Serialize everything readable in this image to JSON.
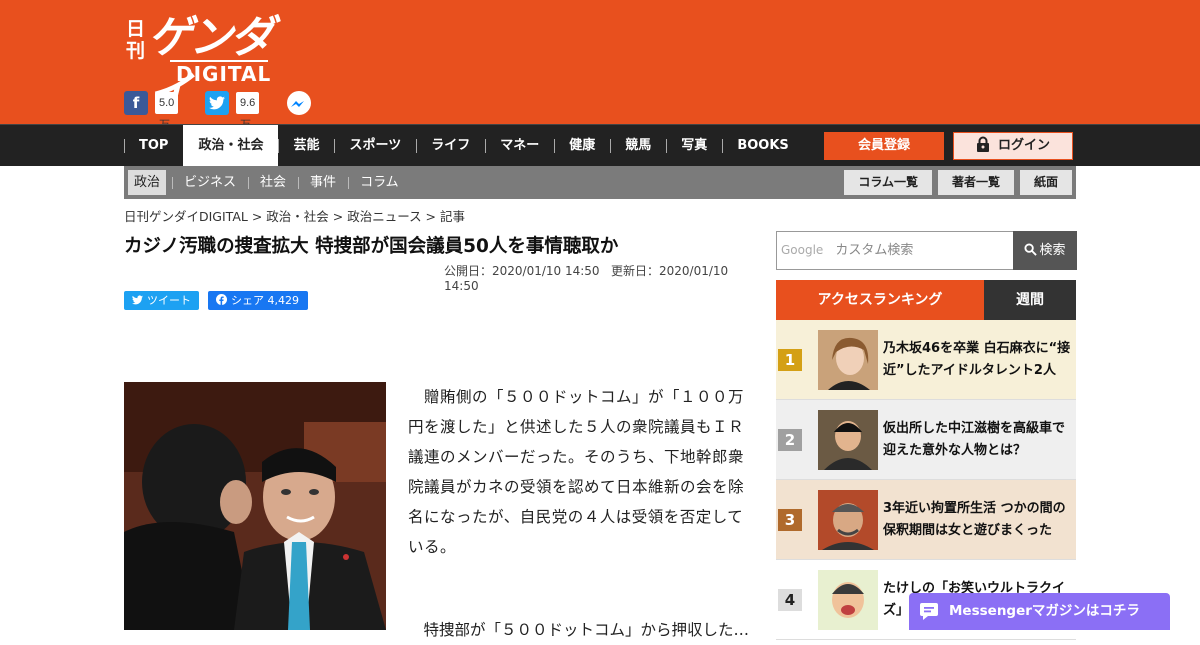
{
  "header": {
    "logo_small": "日刊",
    "logo_main": "ゲンダイ",
    "logo_digital": "DIGITAL",
    "facebook_count": "5.0万",
    "twitter_count": "9.6万",
    "brand_color": "#e8501e"
  },
  "nav": {
    "items": [
      "TOP",
      "政治・社会",
      "芸能",
      "スポーツ",
      "ライフ",
      "マネー",
      "健康",
      "競馬",
      "写真",
      "BOOKS"
    ],
    "register_label": "会員登録",
    "login_label": "ログイン"
  },
  "subnav": {
    "items": [
      "政治",
      "ビジネス",
      "社会",
      "事件",
      "コラム"
    ],
    "right_buttons": [
      "コラム一覧",
      "著者一覧",
      "紙面"
    ]
  },
  "breadcrumb": "日刊ゲンダイDIGITAL > 政治・社会 > 政治ニュース > 記事",
  "article": {
    "title": "カジノ汚職の捜査拡大 特捜部が国会議員50人を事情聴取か",
    "published": "公開日：2020/01/10 14:50",
    "updated": "更新日：2020/01/10 14:50",
    "tweet_label": "ツイート",
    "share_label": "シェア 4,429",
    "paragraph1": "　贈賄側の「５００ドットコム」が「１００万円を渡した」と供述した５人の衆院議員もＩＲ議連のメンバーだった。そのうち、下地幹郎衆院議員がカネの受領を認めて日本維新の会を除名になったが、自民党の４人は受領を否定している。",
    "paragraph2": "　特捜部が「５００ドットコム」から押収した…"
  },
  "sidebar": {
    "search_google": "Google",
    "search_placeholder": "カスタム検索",
    "search_button": "検索",
    "ranking_tab_access": "アクセスランキング",
    "ranking_tab_weekly": "週間",
    "ranking": [
      {
        "num": "1",
        "text": "乃木坂46を卒業 白石麻衣に“接近”したアイドルタレント2人"
      },
      {
        "num": "2",
        "text": "仮出所した中江滋樹を高級車で迎えた意外な人物とは？"
      },
      {
        "num": "3",
        "text": "3年近い拘置所生活 つかの間の保釈期間は女と遊びまくった"
      },
      {
        "num": "4",
        "text": "たけしの「お笑いウルトラクイズ」"
      }
    ]
  },
  "messenger_label": "Messengerマガジンはコチラ"
}
